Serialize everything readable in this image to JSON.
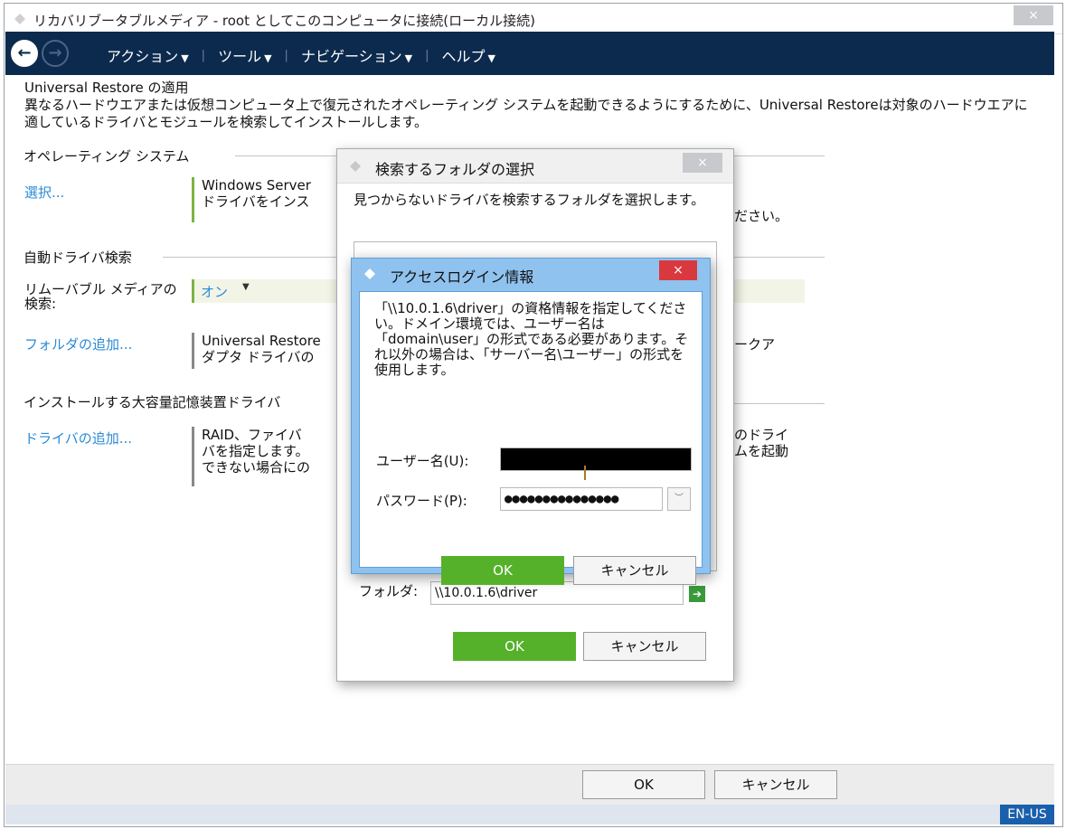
{
  "window": {
    "title": "リカバリブータブルメディア - root としてこのコンピュータに接続(ローカル接続)",
    "close_label": "×"
  },
  "menu": {
    "back_icon": "back-arrow-icon",
    "forward_icon": "forward-arrow-icon",
    "items": [
      {
        "label": "アクション"
      },
      {
        "label": "ツール"
      },
      {
        "label": "ナビゲーション"
      },
      {
        "label": "ヘルプ"
      }
    ]
  },
  "page": {
    "title": "Universal Restore の適用",
    "description": "異なるハードウエアまたは仮想コンピュータ上で復元されたオペレーティング システムを起動できるようにするために、Universal Restoreは対象のハードウエアに適しているドライバとモジュールを検索してインストールします。"
  },
  "sections": {
    "os": {
      "heading": "オペレーティング システム",
      "link": "選択...",
      "info_line1": "Windows Server",
      "info_line2": "ドライバをインス",
      "right_fragment": "ださい。"
    },
    "auto": {
      "heading": "自動ドライバ検索",
      "removable_label": "リムーバブル メディアの検索:",
      "removable_value": "オン",
      "folder_link": "フォルダの追加...",
      "folder_info_line1": "Universal Restore",
      "folder_info_line2": "ダプタ ドライバの",
      "right_fragment": "ークア"
    },
    "mass": {
      "heading": "インストールする大容量記憶装置ドライバ",
      "link": "ドライバの追加...",
      "info_line1": "RAID、ファイバ",
      "info_line2": "バを指定します。",
      "info_line3": "できない場合にの",
      "right_line1": "のドライ",
      "right_line2": "ムを起動"
    }
  },
  "footer": {
    "ok": "OK",
    "cancel": "キャンセル",
    "language": "EN-US"
  },
  "folder_dialog": {
    "title": "検索するフォルダの選択",
    "close_label": "×",
    "description": "見つからないドライバを検索するフォルダを選択します。",
    "folder_label": "フォルダ:",
    "folder_value": "\\\\10.0.1.6\\driver",
    "go_icon": "go-arrow-icon",
    "ok": "OK",
    "cancel": "キャンセル"
  },
  "login_dialog": {
    "title": "アクセスログイン情報",
    "close_label": "×",
    "message": "「\\\\10.0.1.6\\driver」の資格情報を指定してください。ドメイン環境では、ユーザー名は「domain\\user」の形式である必要があります。それ以外の場合は、「サーバー名\\ユーザー」の形式を使用します。",
    "username_label": "ユーザー名(U):",
    "username_value": "",
    "password_label": "パスワード(P):",
    "password_value": "●●●●●●●●●●●●●●●",
    "ok": "OK",
    "cancel": "キャンセル"
  },
  "colors": {
    "menubar": "#0c2a4d",
    "link": "#2a8ad6",
    "primary_button": "#55b12a",
    "login_frame": "#8fc2ee",
    "close_red": "#d9393e",
    "lang_badge": "#1a5fab"
  }
}
